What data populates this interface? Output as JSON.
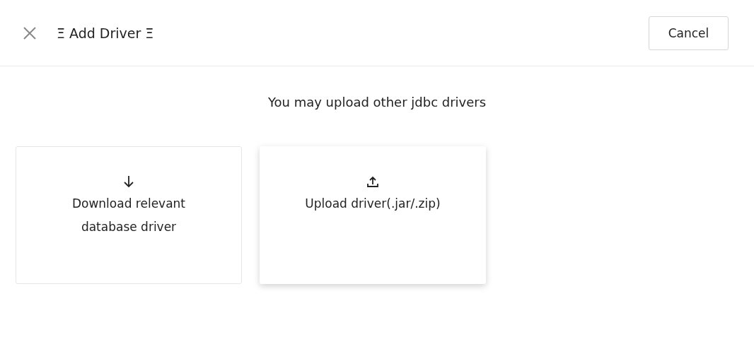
{
  "header": {
    "title": "Ξ Add Driver Ξ",
    "cancel_button": "Cancel"
  },
  "subtitle": "You may upload other jdbc drivers",
  "options": [
    {
      "kind": "download",
      "label": "Download relevant database driver",
      "selected": false
    },
    {
      "kind": "upload",
      "label": "Upload driver(.jar/.zip)",
      "selected": true
    }
  ]
}
